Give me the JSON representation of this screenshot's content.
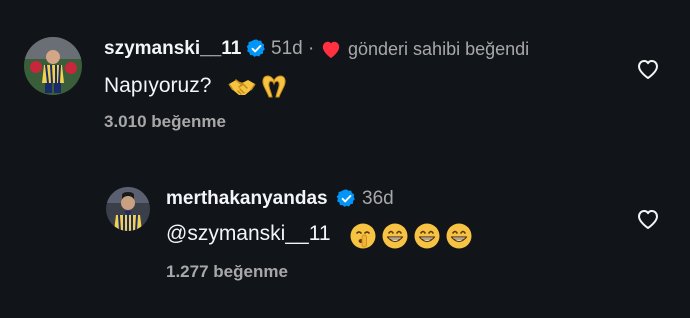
{
  "comments": [
    {
      "username": "szymanski__11",
      "time": "51d",
      "separator": "·",
      "liked_by_author": "gönderi sahibi beğendi",
      "text": "Napıyoruz?",
      "emojis": [
        "handshake-emoji",
        "heart-hands-emoji"
      ],
      "likes": "3.010 beğenme",
      "avatar": "player-avatar-szymanski"
    },
    {
      "username": "merthakanyandas",
      "time": "36d",
      "text": "@szymanski__11",
      "emojis": [
        "shushing-face-emoji",
        "grinning-face-emoji",
        "grinning-face-emoji",
        "grinning-face-emoji"
      ],
      "likes": "1.277 beğenme",
      "avatar": "player-avatar-merthakan"
    }
  ],
  "colors": {
    "background": "#111419",
    "text_primary": "#f3f5f7",
    "text_secondary": "#a8a8a8",
    "verified": "#0095f6",
    "heart_red": "#ff3040"
  },
  "icons": {
    "like": "heart-outline-icon",
    "verified": "verified-badge-icon",
    "liked_by_author": "heart-filled-icon"
  }
}
